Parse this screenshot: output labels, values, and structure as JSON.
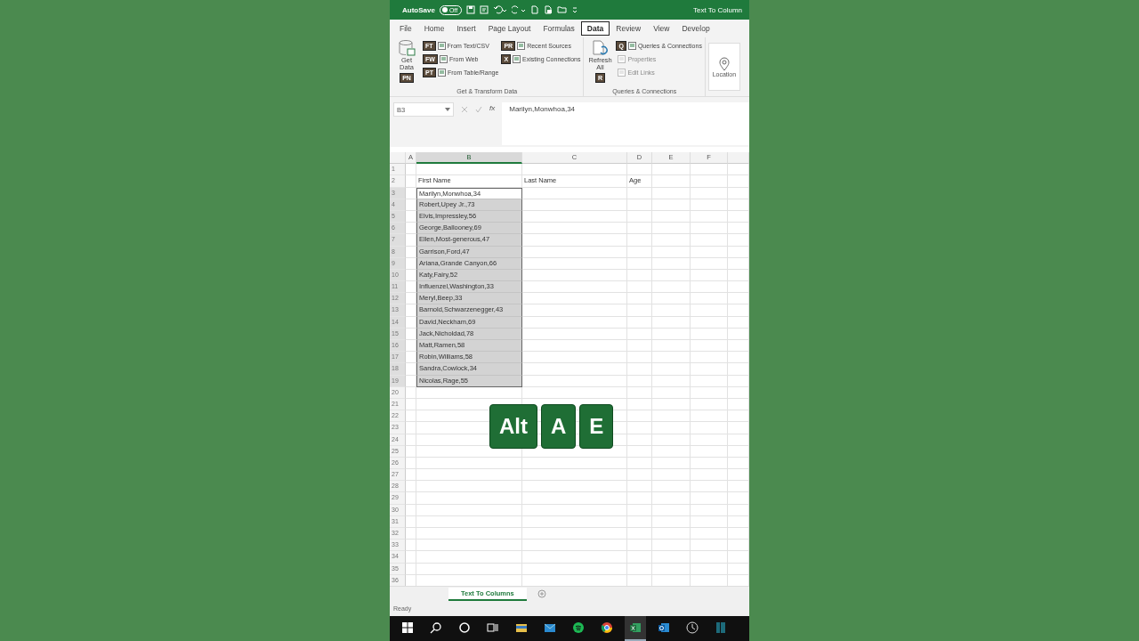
{
  "title_bar": {
    "autosave_label": "AutoSave",
    "autosave_state": "Off",
    "autosave_on": false,
    "title": "Text To Column"
  },
  "ribbon_tabs": [
    {
      "label": "File",
      "selected": false
    },
    {
      "label": "Home",
      "selected": false
    },
    {
      "label": "Insert",
      "selected": false
    },
    {
      "label": "Page Layout",
      "selected": false
    },
    {
      "label": "Formulas",
      "selected": false
    },
    {
      "label": "Data",
      "selected": true
    },
    {
      "label": "Review",
      "selected": false
    },
    {
      "label": "View",
      "selected": false
    },
    {
      "label": "Develop",
      "selected": false
    }
  ],
  "ribbon_groups": [
    {
      "name": "Get & Transform Data",
      "big_button": "Get Data",
      "big_key": "PN",
      "items": [
        {
          "label": "From Text/CSV",
          "key": "FT",
          "disabled": false
        },
        {
          "label": "From Web",
          "key": "FW",
          "disabled": false
        },
        {
          "label": "From Table/Range",
          "key": "PT",
          "disabled": false
        },
        {
          "label": "Recent Sources",
          "key": "PR",
          "disabled": false
        },
        {
          "label": "Existing Connections",
          "key": "X",
          "disabled": false
        }
      ]
    },
    {
      "name": "Queries & Connections",
      "big_button": "Refresh All",
      "big_key": "R",
      "items": [
        {
          "label": "Queries & Connections",
          "key": "Q",
          "disabled": false
        },
        {
          "label": "Properties",
          "disabled": true
        },
        {
          "label": "Edit Links",
          "disabled": true
        }
      ]
    }
  ],
  "ribbon_last_button": "Location",
  "formula_bar": {
    "name_box": "B3",
    "fx": "fx",
    "formula": "Marilyn,Monwhoa,34"
  },
  "columns": [
    {
      "label": "A",
      "selected": false
    },
    {
      "label": "B",
      "selected": true
    },
    {
      "label": "C",
      "selected": false
    },
    {
      "label": "D",
      "selected": false
    },
    {
      "label": "E",
      "selected": false
    },
    {
      "label": "F",
      "selected": false
    }
  ],
  "rows": [
    {
      "number": "1",
      "selected": false,
      "active": false
    },
    {
      "number": "2",
      "b": "First Name",
      "c": "Last Name",
      "d": "Age",
      "selected": false,
      "active": false
    },
    {
      "number": "3",
      "b": "Marilyn,Monwhoa,34",
      "selected": true,
      "active": true
    },
    {
      "number": "4",
      "b": "Robert,Upey Jr.,73",
      "selected": true,
      "active": false
    },
    {
      "number": "5",
      "b": "Elvis,Impressley,56",
      "selected": true,
      "active": false
    },
    {
      "number": "6",
      "b": "George,Ballooney,69",
      "selected": true,
      "active": false
    },
    {
      "number": "7",
      "b": "Ellen,Most-generous,47",
      "selected": true,
      "active": false
    },
    {
      "number": "8",
      "b": "Garrison,Ford,47",
      "selected": true,
      "active": false
    },
    {
      "number": "9",
      "b": "Ariana,Grande Canyon,66",
      "selected": true,
      "active": false
    },
    {
      "number": "10",
      "b": "Katy,Fairy,52",
      "selected": true,
      "active": false
    },
    {
      "number": "11",
      "b": "Influenzel,Washington,33",
      "selected": true,
      "active": false
    },
    {
      "number": "12",
      "b": "Meryl,Beep,33",
      "selected": true,
      "active": false
    },
    {
      "number": "13",
      "b": "Barnold,Schwarzenegger,43",
      "selected": true,
      "active": false
    },
    {
      "number": "14",
      "b": "David,Neckham,69",
      "selected": true,
      "active": false
    },
    {
      "number": "15",
      "b": "Jack,Nicholdad,78",
      "selected": true,
      "active": false
    },
    {
      "number": "16",
      "b": "Matt,Ramen,58",
      "selected": true,
      "active": false
    },
    {
      "number": "17",
      "b": "Robin,Williams,58",
      "selected": true,
      "active": false
    },
    {
      "number": "18",
      "b": "Sandra,Cowlock,34",
      "selected": true,
      "active": false
    },
    {
      "number": "19",
      "b": "Nicolas,Rage,55",
      "selected": true,
      "active": false
    },
    {
      "number": "20",
      "selected": false,
      "active": false
    },
    {
      "number": "21",
      "selected": false,
      "active": false
    },
    {
      "number": "22",
      "selected": false,
      "active": false
    },
    {
      "number": "23",
      "selected": false,
      "active": false
    },
    {
      "number": "24",
      "selected": false,
      "active": false
    },
    {
      "number": "25",
      "selected": false,
      "active": false
    },
    {
      "number": "26",
      "selected": false,
      "active": false
    },
    {
      "number": "27",
      "selected": false,
      "active": false
    },
    {
      "number": "28",
      "selected": false,
      "active": false
    },
    {
      "number": "29",
      "selected": false,
      "active": false
    },
    {
      "number": "30",
      "selected": false,
      "active": false
    },
    {
      "number": "31",
      "selected": false,
      "active": false
    },
    {
      "number": "32",
      "selected": false,
      "active": false
    },
    {
      "number": "33",
      "selected": false,
      "active": false
    },
    {
      "number": "34",
      "selected": false,
      "active": false
    },
    {
      "number": "35",
      "selected": false,
      "active": false
    },
    {
      "number": "36",
      "selected": false,
      "active": false
    }
  ],
  "keys_pressed": [
    {
      "label": "Alt"
    },
    {
      "label": "A"
    },
    {
      "label": "E"
    }
  ],
  "sheet_tabs": [
    {
      "label": "Text To Columns",
      "selected": true
    }
  ],
  "status_bar": {
    "text": "Ready"
  },
  "taskbar": [
    {
      "kind": "start",
      "selected": false
    },
    {
      "kind": "search",
      "selected": false
    },
    {
      "kind": "cortana",
      "selected": false
    },
    {
      "kind": "taskview",
      "selected": false
    },
    {
      "kind": "folder",
      "selected": false
    },
    {
      "kind": "mail",
      "selected": false
    },
    {
      "kind": "music",
      "selected": false
    },
    {
      "kind": "browser",
      "selected": false
    },
    {
      "kind": "sheet",
      "selected": true
    },
    {
      "kind": "outlook",
      "selected": false
    },
    {
      "kind": "clock",
      "selected": false
    },
    {
      "kind": "panel",
      "selected": false
    }
  ]
}
